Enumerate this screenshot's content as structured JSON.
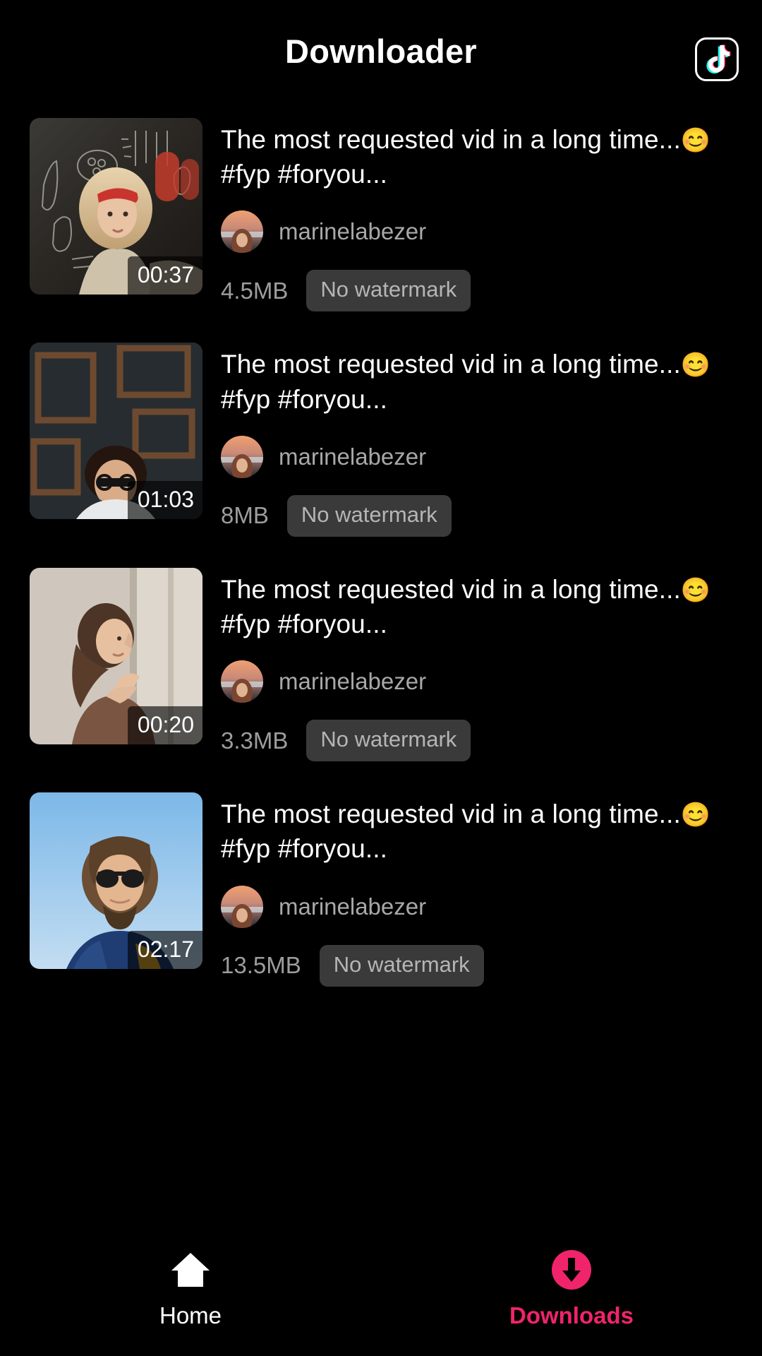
{
  "header": {
    "title": "Downloader",
    "brand_icon": "tiktok-logo-icon"
  },
  "colors": {
    "background": "#000000",
    "accent": "#f0246b",
    "title_text": "#ffffff",
    "secondary_text": "#a8a8a8",
    "chip_background": "#3a3a3a",
    "chip_text": "#b5b5b5",
    "tiktok_cyan": "#25f4ee",
    "tiktok_red": "#fe2c55"
  },
  "downloads": [
    {
      "title_line1": "The most requested vid in a long",
      "title_line2_prefix": "time...",
      "emoji": "😊",
      "title_line2_suffix": "#fyp #foryou...",
      "author": "marinelabezer",
      "duration": "00:37",
      "filesize": "4.5MB",
      "watermark": "No watermark",
      "thumbnail_name": "woman-red-bandana-cafe-thumbnail"
    },
    {
      "title_line1": "The most requested vid in a long",
      "title_line2_prefix": "time...",
      "emoji": "😊",
      "title_line2_suffix": "#fyp #foryou...",
      "author": "marinelabezer",
      "duration": "01:03",
      "filesize": "8MB",
      "watermark": "No watermark",
      "thumbnail_name": "man-glasses-picture-frames-thumbnail"
    },
    {
      "title_line1": "The most requested vid in a long",
      "title_line2_prefix": "time...",
      "emoji": "😊",
      "title_line2_suffix": "#fyp #foryou...",
      "author": "marinelabezer",
      "duration": "00:20",
      "filesize": "3.3MB",
      "watermark": "No watermark",
      "thumbnail_name": "woman-looking-up-wall-thumbnail"
    },
    {
      "title_line1": "The most requested vid in a long",
      "title_line2_prefix": "time...",
      "emoji": "😊",
      "title_line2_suffix": "#fyp #foryou...",
      "author": "marinelabezer",
      "duration": "02:17",
      "filesize": "13.5MB",
      "watermark": "No watermark",
      "thumbnail_name": "man-sunglasses-blue-sky-thumbnail"
    }
  ],
  "bottom_nav": {
    "items": [
      {
        "label": "Home",
        "icon": "home-icon",
        "active": false
      },
      {
        "label": "Downloads",
        "icon": "download-circle-icon",
        "active": true
      }
    ]
  }
}
